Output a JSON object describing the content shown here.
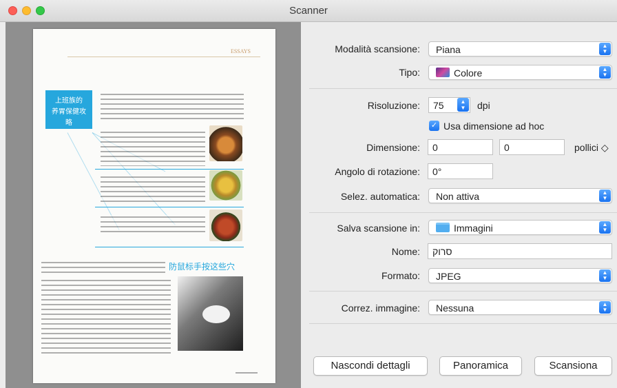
{
  "window": {
    "title": "Scanner"
  },
  "preview": {
    "page_header": "ESSAYS",
    "box_title_line1": "上班族的",
    "box_title_line2": "养胃保健攻略",
    "bottom_heading": "防鼠标手按这些穴"
  },
  "form": {
    "mode": {
      "label": "Modalità scansione:",
      "value": "Piana"
    },
    "type": {
      "label": "Tipo:",
      "value": "Colore",
      "icon": "color-swatch-icon"
    },
    "resolution": {
      "label": "Risoluzione:",
      "value": "75",
      "unit": "dpi"
    },
    "custom_size": {
      "label": "Usa dimensione ad hoc",
      "checked": true
    },
    "dimension": {
      "label": "Dimensione:",
      "width": "0",
      "height": "0",
      "unit": "pollici ◇"
    },
    "rotation": {
      "label": "Angolo di rotazione:",
      "value": "0°"
    },
    "auto_select": {
      "label": "Selez. automatica:",
      "value": "Non attiva"
    },
    "save_in": {
      "label": "Salva scansione in:",
      "value": "Immagini",
      "icon": "folder-icon"
    },
    "name": {
      "label": "Nome:",
      "value": "סרוק"
    },
    "format": {
      "label": "Formato:",
      "value": "JPEG"
    },
    "correction": {
      "label": "Correz. immagine:",
      "value": "Nessuna"
    }
  },
  "buttons": {
    "hide_details": "Nascondi dettagli",
    "overview": "Panoramica",
    "scan": "Scansiona"
  },
  "colors": {
    "accent": "#1a73f0",
    "preview_bg": "#8f8f8f",
    "magazine_blue": "#26a7dd"
  }
}
